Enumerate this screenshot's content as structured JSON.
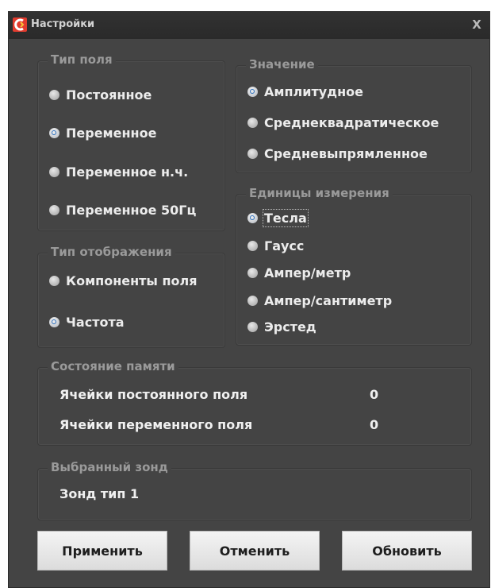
{
  "window": {
    "title": "Настройки",
    "close_label": "X"
  },
  "field_type": {
    "legend": "Тип поля",
    "options": [
      "Постоянное",
      "Переменное",
      "Переменное н.ч.",
      "Переменное 50Гц"
    ],
    "selected": "Переменное"
  },
  "value": {
    "legend": "Значение",
    "options": [
      "Амплитудное",
      "Среднеквадратическое",
      "Средневыпрямленное"
    ],
    "selected": "Амплитудное"
  },
  "display_type": {
    "legend": "Тип отображения",
    "options": [
      "Компоненты поля",
      "Частота"
    ],
    "selected": "Частота"
  },
  "units": {
    "legend": "Единицы измерения",
    "options": [
      "Тесла",
      "Гаусс",
      "Ампер/метр",
      "Ампер/сантиметр",
      "Эрстед"
    ],
    "selected": "Тесла"
  },
  "memory": {
    "legend": "Состояние памяти",
    "rows": [
      {
        "label": "Ячейки постоянного поля",
        "value": "0"
      },
      {
        "label": "Ячейки переменного поля",
        "value": "0"
      }
    ]
  },
  "probe": {
    "legend": "Выбранный зонд",
    "value": "Зонд тип 1"
  },
  "buttons": {
    "apply": "Применить",
    "cancel": "Отменить",
    "refresh": "Обновить"
  },
  "colors": {
    "window_bg": "#444444",
    "titlebar_bg": "#2e2e2e",
    "accent_icon": "#e23b2e",
    "radio_check": "#2a6fbf"
  }
}
